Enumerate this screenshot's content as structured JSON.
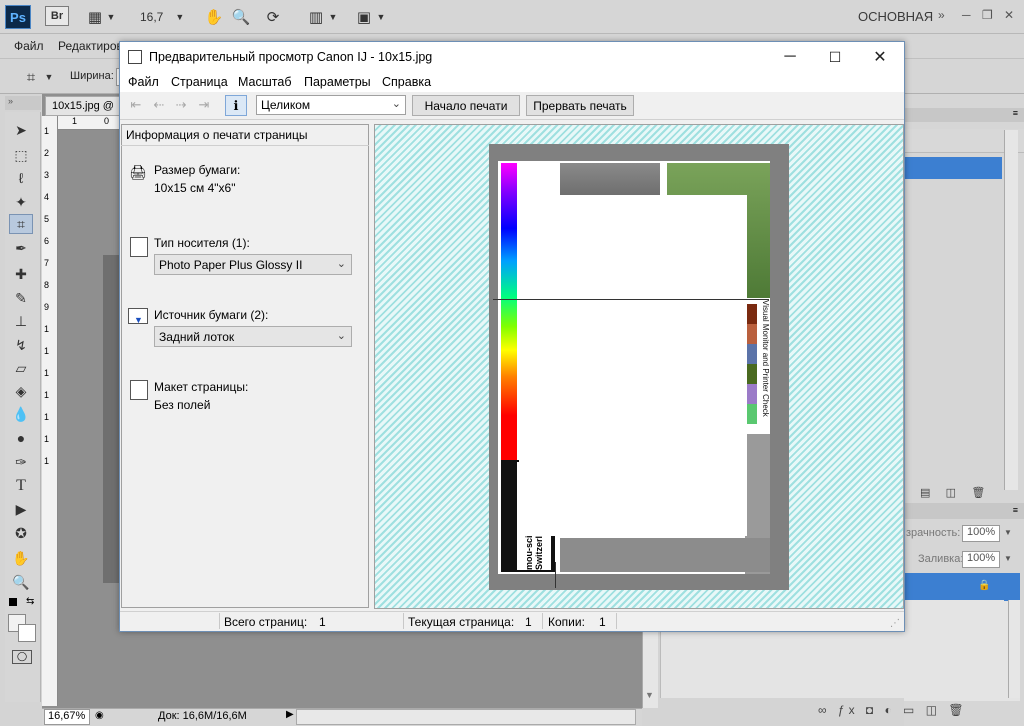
{
  "photoshop": {
    "logo": "Ps",
    "bridge": "Br",
    "zoom_value": "16,7",
    "workspace": "ОСНОВНАЯ",
    "menu": [
      "Файл",
      "Редактиров"
    ],
    "options_label": "Ширина",
    "doc_tab": "10x15.jpg @",
    "status_zoom": "16,67%",
    "status_doc": "Док: 16,6M/16,6M",
    "ruler_top": [
      "1",
      "0"
    ],
    "ruler_left": [
      "1",
      "2",
      "3",
      "4",
      "5",
      "6",
      "7",
      "8",
      "9",
      "1",
      "1",
      "1",
      "1",
      "1",
      "1",
      "1"
    ],
    "right_panel": {
      "opacity_label": "Непрозрачность:",
      "opacity_label_visible": "зрачность:",
      "opacity_value": "100%",
      "fill_label": "Заливка:",
      "fill_value": "100%"
    }
  },
  "dialog": {
    "title": "Предварительный просмотр Canon IJ - 10x15.jpg",
    "menu": [
      "Файл",
      "Страница",
      "Масштаб",
      "Параметры",
      "Справка"
    ],
    "zoom_option": "Целиком",
    "start_print_button": "Начало печати",
    "cancel_print_button": "Прервать печать",
    "info_header": "Информация о печати страницы",
    "paper_size_label": "Размер бумаги:",
    "paper_size_value": "10x15 см 4\"x6\"",
    "media_type_label": "Тип носителя (1):",
    "media_type_value": "Photo Paper Plus Glossy II",
    "paper_source_label": "Источник бумаги (2):",
    "paper_source_value": "Задний лоток",
    "page_layout_label": "Макет страницы:",
    "page_layout_value": "Без полей",
    "preview_strip_text": "mou-science.com Switzerland",
    "preview_side_text": "Visual Monitor and Printer Check",
    "status": {
      "total_pages_label": "Всего страниц:",
      "total_pages_value": "1",
      "current_page_label": "Текущая страница:",
      "current_page_value": "1",
      "copies_label": "Копии:",
      "copies_value": "1"
    }
  },
  "colors": {
    "preview_hatch": "#9fe0e0",
    "selection_blue": "#3c7fd1"
  }
}
